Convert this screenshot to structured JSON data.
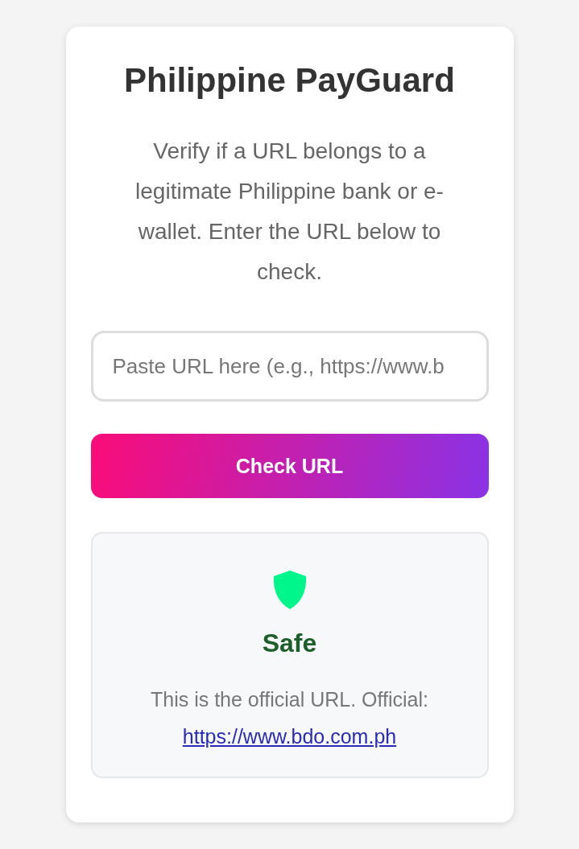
{
  "title": "Philippine PayGuard",
  "description": "Verify if a URL belongs to a legitimate Philippine bank or e-wallet. Enter the URL below to check.",
  "url_field": {
    "placeholder": "Paste URL here (e.g., https://www.b"
  },
  "check_button": "Check URL",
  "result": {
    "kind": "safe",
    "label": "Safe",
    "message": "This is the official URL. Official:",
    "link": "https://www.bdo.com.ph"
  }
}
